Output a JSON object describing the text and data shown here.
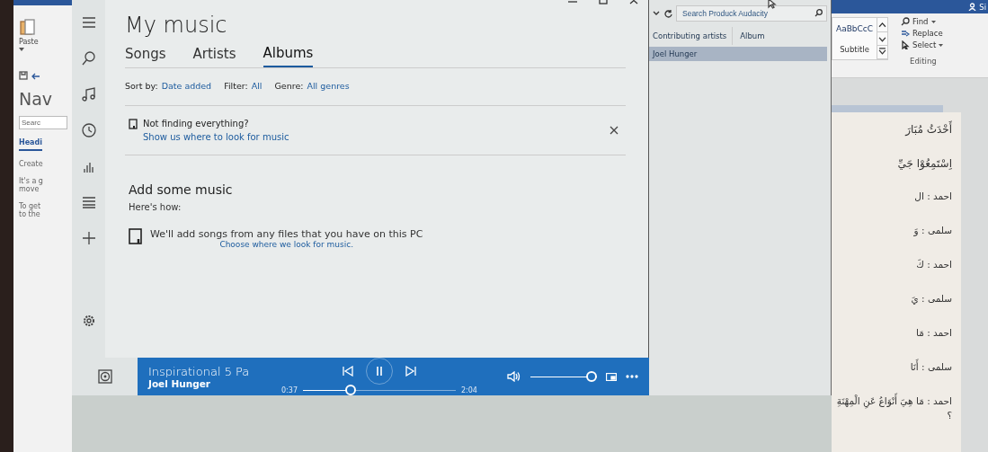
{
  "word_left": {
    "paste_label": "Paste",
    "nav_title": "Nav",
    "search": {
      "placeholder": "Searc"
    },
    "tab": {
      "label": "Headi",
      "selected": true
    },
    "texts": [
      "Create",
      "It's a g",
      "move",
      "To get",
      "to the"
    ]
  },
  "groove": {
    "title": "My music",
    "tabs": [
      {
        "label": "Songs",
        "selected": false
      },
      {
        "label": "Artists",
        "selected": false
      },
      {
        "label": "Albums",
        "selected": true
      }
    ],
    "filters": [
      {
        "label": "Sort by:",
        "value": "Date added"
      },
      {
        "label": "Filter:",
        "value": "All"
      },
      {
        "label": "Genre:",
        "value": "All genres"
      }
    ],
    "notice": {
      "title": "Not finding everything?",
      "link": "Show us where to look for music"
    },
    "add_section": {
      "heading": "Add some music",
      "intro": "Here's how:",
      "steps": [
        {
          "text": "We'll add songs from any files that you have on this PC",
          "link": "Choose where we look for music."
        }
      ]
    },
    "player": {
      "title": "Inspirational 5 Pa",
      "artist": "Joel Hunger",
      "playing": true,
      "elapsed": "0:37",
      "duration": "2:04",
      "progress": {
        "level": 0.3
      },
      "volume": {
        "level": 1
      }
    }
  },
  "explorer": {
    "search": {
      "placeholder": "Search Produck Audacity"
    },
    "columns": [
      "Contributing artists",
      "Album"
    ],
    "rows": [
      {
        "cells": [
          "Joel Hunger"
        ],
        "selected": true
      }
    ]
  },
  "word_right": {
    "account": "Si",
    "styles": [
      {
        "preview": "AaBbCcC",
        "name": "Subtitle"
      }
    ],
    "editing": {
      "items": [
        {
          "label": "Find",
          "dropdown": true
        },
        {
          "label": "Replace",
          "dropdown": false
        },
        {
          "label": "Select",
          "dropdown": true
        }
      ],
      "group_label": "Editing"
    },
    "document_lines": [
      {
        "kind": "heading",
        "text": "أَحْدَثُ مُبَارَ"
      },
      {
        "kind": "heading",
        "text": "اِسْتَمِعُوْا جَيِّ"
      },
      {
        "kind": "dialog",
        "text": "احمد : ال"
      },
      {
        "kind": "dialog",
        "text": "سلمى : وَ"
      },
      {
        "kind": "dialog",
        "text": "احمد : كَ"
      },
      {
        "kind": "dialog",
        "text": "سلمى : يَ"
      },
      {
        "kind": "dialog",
        "text": "احمد : مَا"
      },
      {
        "kind": "dialog",
        "text": "سلمى : أَنَا"
      },
      {
        "kind": "dialog",
        "text": "احمد : مَا هِيَ أَنْوَاعُ عَنِ الْمِهْنَةِ ؟"
      }
    ]
  }
}
